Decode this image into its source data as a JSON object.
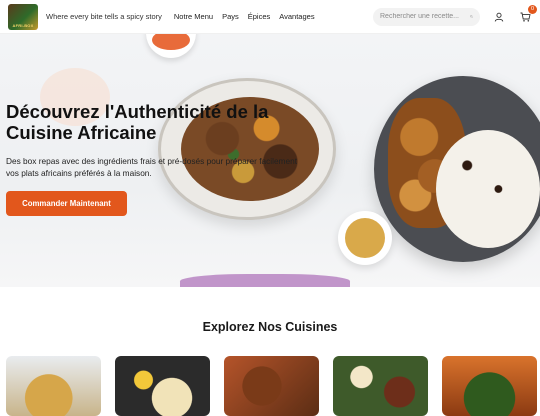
{
  "header": {
    "logo_text": "AFRI-BOX",
    "tagline": "Where every bite tells a spicy story",
    "nav": [
      "Notre Menu",
      "Pays",
      "Épices",
      "Avantages"
    ],
    "search_placeholder": "Rechercher une recette...",
    "cart_count": "0"
  },
  "hero": {
    "title": "Découvrez l'Authenticité de la Cuisine Africaine",
    "subtitle": "Des box repas avec des ingrédients frais et pré-dosés pour préparer facilement vos plats africains préférés à la maison.",
    "cta_label": "Commander Maintenant"
  },
  "cuisines": {
    "title": "Explorez Nos Cuisines"
  },
  "colors": {
    "accent": "#e2571c"
  }
}
